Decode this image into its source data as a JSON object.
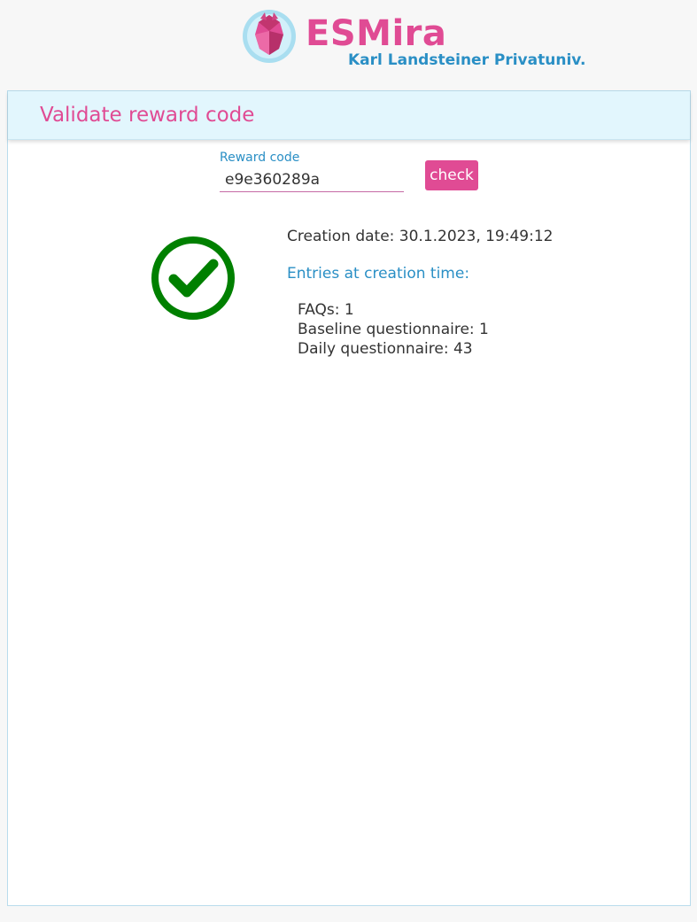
{
  "header": {
    "brand_name": "ESMira",
    "brand_subtitle": "Karl Landsteiner Privatuniv.",
    "logo_icon": "esmira-logo-icon"
  },
  "panel": {
    "title": "Validate reward code"
  },
  "reward_form": {
    "label": "Reward code",
    "value": "e9e360289a",
    "check_label": "check"
  },
  "result": {
    "status_icon": "check-circle-icon",
    "status_color": "#008000",
    "creation_date": "Creation date: 30.1.2023, 19:49:12",
    "entries_title": "Entries at creation time:",
    "entries": [
      "FAQs: 1",
      "Baseline questionnaire: 1",
      "Daily questionnaire: 43"
    ]
  },
  "colors": {
    "accent_pink": "#e04b94",
    "accent_blue": "#2a8fc5",
    "header_bg": "#e2f6fd"
  }
}
